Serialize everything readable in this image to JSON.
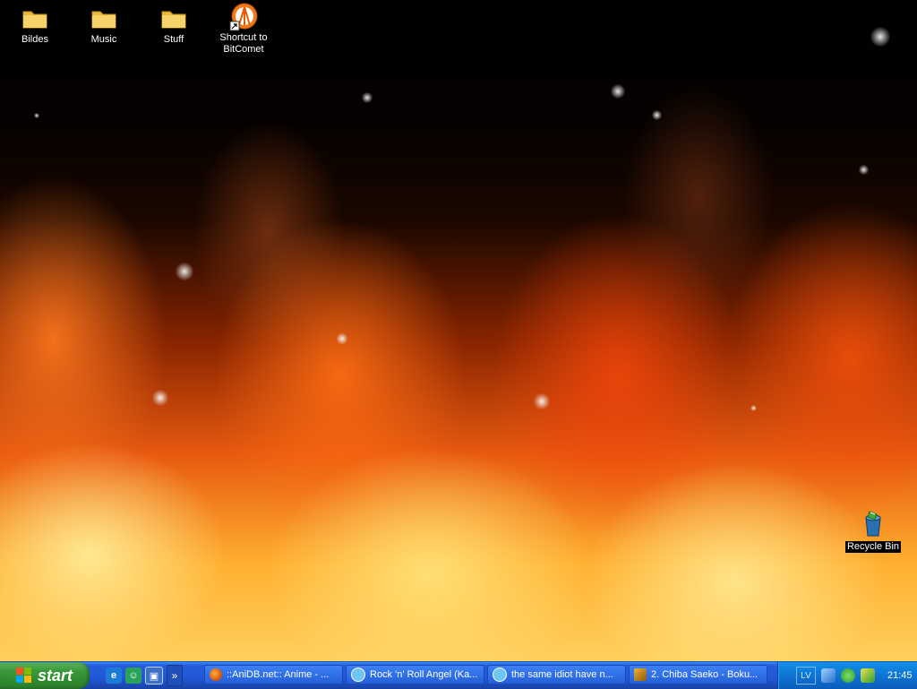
{
  "desktop": {
    "icons": [
      {
        "label": "Bildes",
        "icon": "folder-icon"
      },
      {
        "label": "Music",
        "icon": "folder-icon"
      },
      {
        "label": "Stuff",
        "icon": "folder-icon"
      },
      {
        "label": "Shortcut to BitComet",
        "icon": "bitcomet-shortcut-icon"
      },
      {
        "label": "Recycle Bin",
        "icon": "recycle-bin-icon"
      }
    ]
  },
  "taskbar": {
    "start_label": "start",
    "quick_launch": [
      {
        "icon": "internet-explorer-icon"
      },
      {
        "icon": "messenger-icon"
      },
      {
        "icon": "show-desktop-icon"
      }
    ],
    "quick_launch_more": "»",
    "tasks": [
      {
        "label": "::AniDB.net:: Anime - ...",
        "icon": "firefox-icon"
      },
      {
        "label": "Rock 'n' Roll Angel (Ka...",
        "icon": "chat-icon"
      },
      {
        "label": "the same idiot have n...",
        "icon": "chat-icon"
      },
      {
        "label": "2. Chiba Saeko - Boku...",
        "icon": "winamp-icon"
      }
    ],
    "tray": {
      "language": "LV",
      "icons": [
        "network-icon",
        "messenger-tray-icon",
        "utorrent-tray-icon"
      ],
      "clock": "21:45"
    }
  },
  "colors": {
    "taskbar_blue": "#245edb",
    "start_green": "#3c9a3c",
    "tray_blue": "#0d6fd0"
  }
}
